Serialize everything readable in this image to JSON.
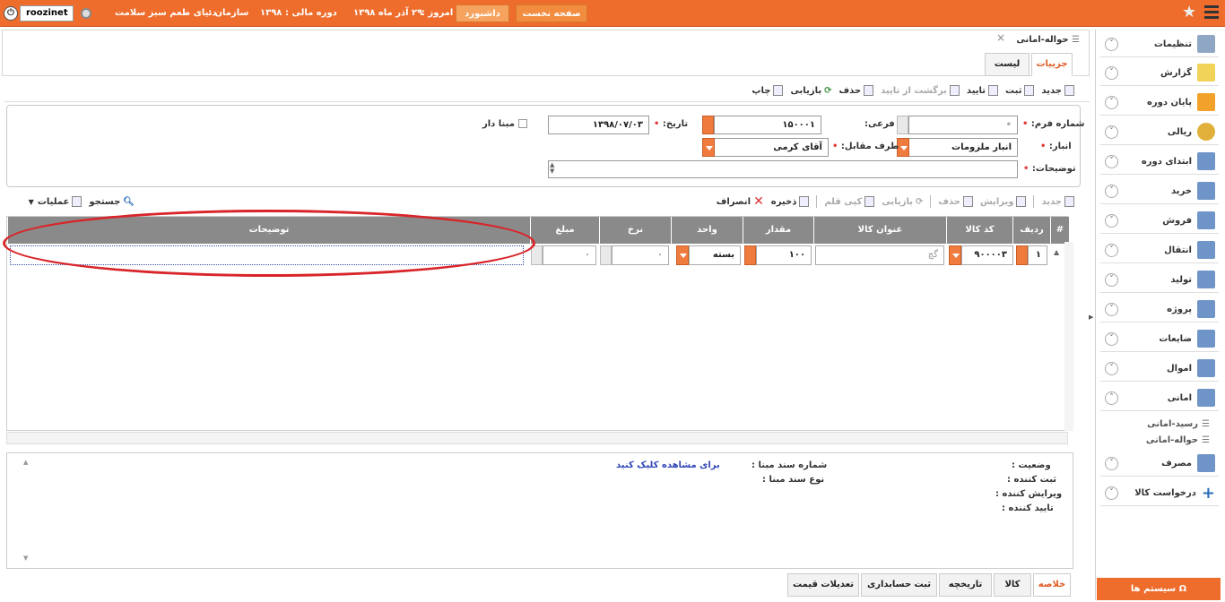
{
  "topbar": {
    "home_tab": "صفحه نخست",
    "dashboard_tab": "داشبورد",
    "today_label": "امروز :",
    "today_value": "۲۹ آذر ماه ۱۳۹۸",
    "fiscal_label": "دوره مالی :",
    "fiscal_value": "۱۳۹۸",
    "org_label": "سازمان :",
    "org_value": "دنیای طعم سبز سلامت",
    "username": "roozinet",
    "accent": "#ee6d2c"
  },
  "panel": {
    "title": "حواله-امانی",
    "tab_details": "جزییات",
    "tab_list": "لیست"
  },
  "toolbar": {
    "new": "جدید",
    "save": "ثبت",
    "confirm": "تایید",
    "unconfirm": "برگشت از تایید",
    "delete": "حذف",
    "refresh": "بازیابی",
    "print": "چاپ"
  },
  "form": {
    "form_no_label": "شماره فرم:",
    "sub_label": "فرعی:",
    "sub_value": "۱۵۰۰۰۱",
    "date_label": "تاریخ:",
    "date_value": "۱۳۹۸/۰۷/۰۳",
    "based_label": "مبنا دار",
    "warehouse_label": "انبار:",
    "warehouse_value": "انبار ملزومات",
    "counterparty_label": "طرف مقابل:",
    "counterparty_value": "آقای کرمی",
    "desc_label": "توضیحات:"
  },
  "grid_toolbar": {
    "new": "جدید",
    "edit": "ویرایش",
    "delete": "حذف",
    "refresh": "بازیابی",
    "copy": "کپی قلم",
    "save": "ذخیره",
    "cancel": "انصراف",
    "search": "جستجو",
    "ops": "عملیات"
  },
  "grid": {
    "columns": [
      "#",
      "ردیف",
      "کد کالا",
      "عنوان کالا",
      "مقدار",
      "واحد",
      "نرخ",
      "مبلغ",
      "توضیحات"
    ],
    "row": {
      "index": "۱",
      "code": "۹۰۰۰۰۳",
      "title": "گچ",
      "qty": "۱۰۰",
      "unit": "بسته",
      "rate": "۰",
      "amount": "۰",
      "desc": ""
    }
  },
  "info": {
    "status_label": "وضعیت :",
    "creator_label": "ثبت کننده :",
    "editor_label": "ویرایش کننده :",
    "approver_label": "تایید کننده :",
    "base_doc_no_label": "شماره سند مبنا :",
    "base_doc_type_label": "نوع سند مبنا :",
    "view_link": "برای مشاهده کلیک کنید"
  },
  "bottom_tabs": [
    "خلاصه",
    "کالا",
    "تاریخچه",
    "ثبت حسابداری",
    "تعدیلات قیمت"
  ],
  "sidebar": {
    "items": [
      "تنظیمات",
      "گزارش",
      "پایان دوره",
      "ریالی",
      "ابتدای دوره",
      "خرید",
      "فروش",
      "انتقال",
      "تولید",
      "پروژه",
      "ضایعات",
      "اموال",
      "امانی"
    ],
    "sub_items": [
      "رسید-امانی",
      "حواله-امانی"
    ],
    "items2": [
      "مصرف",
      "درخواست کالا"
    ],
    "systems": "سیستم ها"
  }
}
